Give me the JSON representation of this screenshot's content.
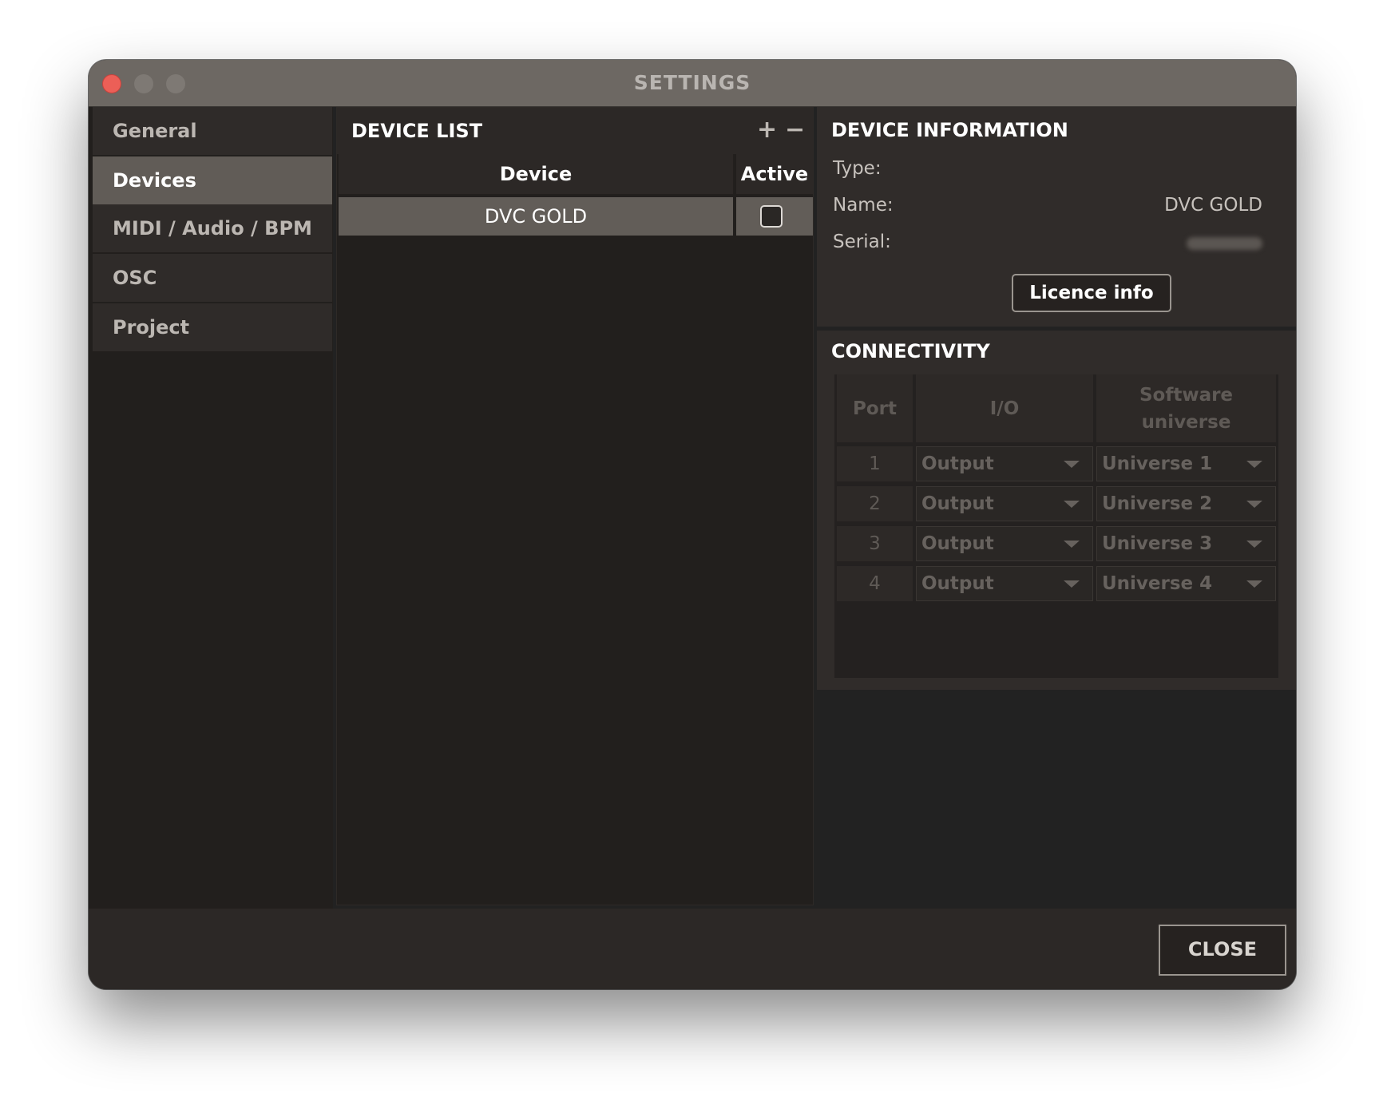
{
  "window": {
    "title": "SETTINGS"
  },
  "sidebar": {
    "items": [
      {
        "label": "General",
        "active": false
      },
      {
        "label": "Devices",
        "active": true
      },
      {
        "label": "MIDI / Audio / BPM",
        "active": false
      },
      {
        "label": "OSC",
        "active": false
      },
      {
        "label": "Project",
        "active": false
      }
    ]
  },
  "device_list": {
    "title": "DEVICE LIST",
    "add_label": "+",
    "remove_label": "−",
    "columns": {
      "device": "Device",
      "active": "Active"
    },
    "rows": [
      {
        "device": "DVC GOLD",
        "active": false
      }
    ]
  },
  "device_info": {
    "title": "DEVICE INFORMATION",
    "type_label": "Type:",
    "type_value": "",
    "name_label": "Name:",
    "name_value": "DVC GOLD",
    "serial_label": "Serial:",
    "licence_button": "Licence info"
  },
  "connectivity": {
    "title": "CONNECTIVITY",
    "headers": {
      "port": "Port",
      "io": "I/O",
      "universe_line1": "Software",
      "universe_line2": "universe"
    },
    "rows": [
      {
        "port": "1",
        "io": "Output",
        "universe": "Universe 1"
      },
      {
        "port": "2",
        "io": "Output",
        "universe": "Universe 2"
      },
      {
        "port": "3",
        "io": "Output",
        "universe": "Universe 3"
      },
      {
        "port": "4",
        "io": "Output",
        "universe": "Universe 4"
      }
    ]
  },
  "footer": {
    "close_label": "CLOSE"
  },
  "colors": {
    "close_dot": "#ec5f57",
    "selected": "#625d58",
    "titlebar": "#6d6863"
  }
}
